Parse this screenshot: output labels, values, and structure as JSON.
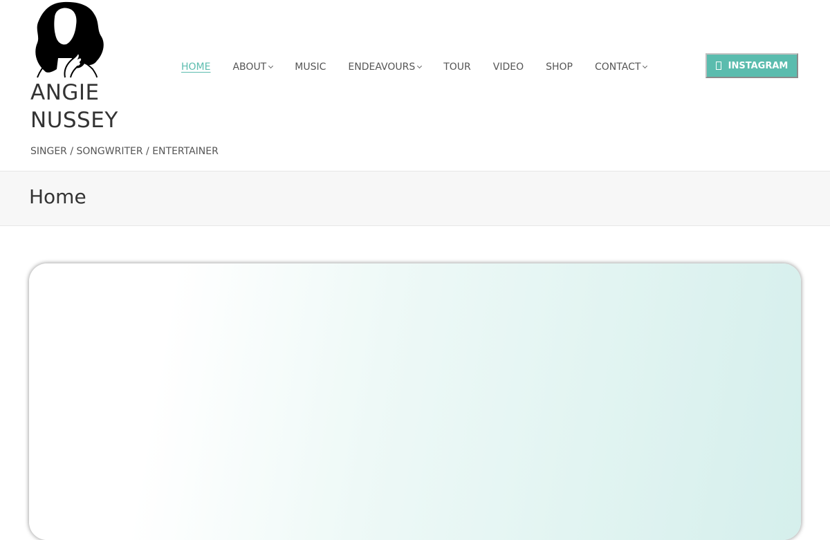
{
  "site": {
    "title_line1": "ANGIE",
    "title_line2": "NUSSEY",
    "tagline": "SINGER / SONGWRITER / ENTERTAINER",
    "logo_icon": "woman-silhouette-logo"
  },
  "nav": {
    "items": [
      {
        "label": "HOME",
        "active": true,
        "has_dropdown": false
      },
      {
        "label": "ABOUT",
        "active": false,
        "has_dropdown": true
      },
      {
        "label": "MUSIC",
        "active": false,
        "has_dropdown": false
      },
      {
        "label": "ENDEAVOURS",
        "active": false,
        "has_dropdown": true
      },
      {
        "label": "TOUR",
        "active": false,
        "has_dropdown": false
      },
      {
        "label": "VIDEO",
        "active": false,
        "has_dropdown": false
      },
      {
        "label": "SHOP",
        "active": false,
        "has_dropdown": false
      },
      {
        "label": "CONTACT",
        "active": false,
        "has_dropdown": true
      }
    ]
  },
  "instagram_button": {
    "label": "INSTAGRAM",
    "icon": "instagram-icon"
  },
  "page": {
    "title": "Home"
  },
  "colors": {
    "accent": "#5bbcae",
    "text": "#333333",
    "nav_text": "#555555",
    "title_bar_bg": "#f7f7f7"
  }
}
